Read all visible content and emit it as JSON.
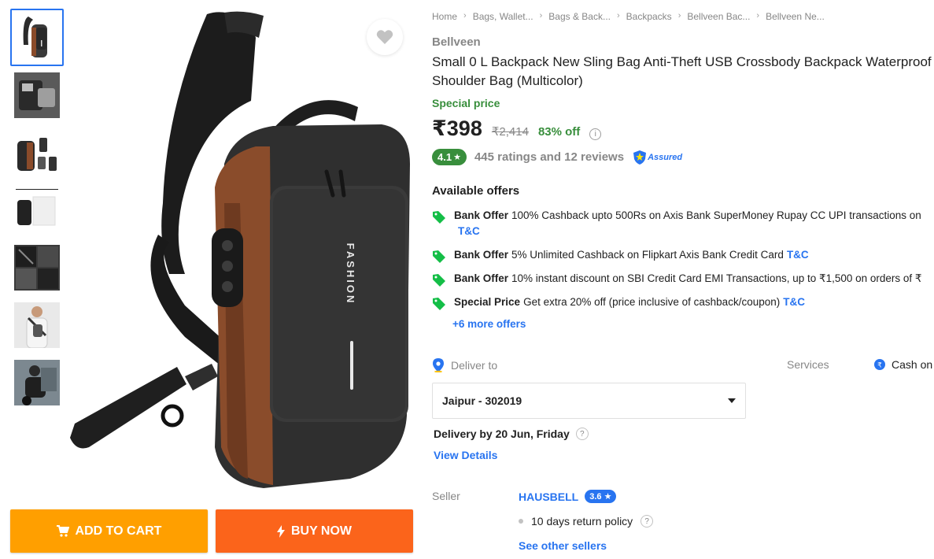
{
  "thumbnails": [
    {
      "name": "thumb-sling-bag-front"
    },
    {
      "name": "thumb-bag-open-interior"
    },
    {
      "name": "thumb-bag-multiple-angles"
    },
    {
      "name": "thumb-bag-with-box"
    },
    {
      "name": "thumb-bag-details"
    },
    {
      "name": "thumb-model-wearing-bag"
    },
    {
      "name": "thumb-model-on-bike"
    }
  ],
  "gallery": {
    "bag_print": "FASHION"
  },
  "buttons": {
    "add_to_cart": "ADD TO CART",
    "buy_now": "BUY NOW"
  },
  "breadcrumbs": [
    "Home",
    "Bags, Wallet...",
    "Bags & Back...",
    "Backpacks",
    "Bellveen Bac...",
    "Bellveen Ne..."
  ],
  "product": {
    "brand": "Bellveen",
    "title": "Small 0 L Backpack New Sling Bag Anti-Theft USB Crossbody Backpack Waterproof Shoulder Bag  (Multicolor)",
    "special_label": "Special price",
    "price": "₹398",
    "mrp": "₹2,414",
    "discount": "83% off",
    "rating": "4.1",
    "rating_star": "★",
    "rating_text": "445 ratings and 12 reviews",
    "assured": "Assured"
  },
  "offers": {
    "heading": "Available offers",
    "items": [
      {
        "type": "Bank Offer",
        "text": "100% Cashback upto 500Rs on Axis Bank SuperMoney Rupay CC UPI transactions on",
        "tc": "T&C"
      },
      {
        "type": "Bank Offer",
        "text": "5% Unlimited Cashback on Flipkart Axis Bank Credit Card",
        "tc": "T&C"
      },
      {
        "type": "Bank Offer",
        "text": "10% instant discount on SBI Credit Card EMI Transactions, up to ₹1,500 on orders of ₹",
        "tc": ""
      },
      {
        "type": "Special Price",
        "text": "Get extra 20% off (price inclusive of cashback/coupon)",
        "tc": "T&C"
      }
    ],
    "more": "+6 more offers"
  },
  "delivery": {
    "label": "Deliver to",
    "pincode": "Jaipur - 302019",
    "delivery_by": "Delivery by 20 Jun, Friday",
    "help": "?",
    "view_details": "View Details"
  },
  "services": {
    "label": "Services",
    "cod": "Cash on"
  },
  "seller": {
    "label": "Seller",
    "name": "HAUSBELL",
    "rating": "3.6 ★",
    "return_policy": "10 days return policy",
    "help": "?",
    "other_sellers": "See other sellers"
  },
  "colors": {
    "flipkart_blue": "#2874f0",
    "green": "#388e3c",
    "cart_orange": "#ff9f00",
    "buy_orange": "#fb641b"
  }
}
